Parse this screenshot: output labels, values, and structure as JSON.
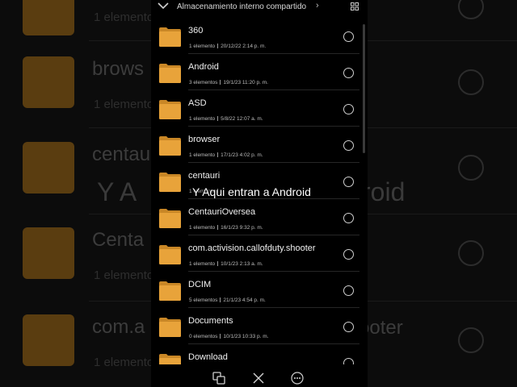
{
  "header": {
    "path_label": "Almacenamiento interno compartido",
    "path_arrow": "›",
    "back_icon": "chevron-down-icon",
    "view_icon": "grid-view-icon"
  },
  "colors": {
    "folder": "#e8a33a",
    "folder_tab": "#c98726",
    "background": "#000000"
  },
  "files": [
    {
      "name": "360",
      "count": "1 elemento",
      "date": "20/12/22 2:14 p. m."
    },
    {
      "name": "Android",
      "count": "3 elementos",
      "date": "19/1/23 11:20 p. m."
    },
    {
      "name": "ASD",
      "count": "1 elemento",
      "date": "5/8/22 12:07 a. m."
    },
    {
      "name": "browser",
      "count": "1 elemento",
      "date": "17/1/23 4:02 p. m."
    },
    {
      "name": "centauri",
      "count": "1 elemento",
      "date": ""
    },
    {
      "name": "CentauriOversea",
      "count": "1 elemento",
      "date": "16/1/23 9:32 p. m."
    },
    {
      "name": "com.activision.callofduty.shooter",
      "count": "1 elemento",
      "date": "10/1/23 2:13 a. m."
    },
    {
      "name": "DCIM",
      "count": "5 elementos",
      "date": "21/1/23 4:54 p. m."
    },
    {
      "name": "Documents",
      "count": "0 elementos",
      "date": "10/1/23 10:33 p. m."
    },
    {
      "name": "Download",
      "count": "",
      "date": ""
    }
  ],
  "overlay_caption": "Y Aqui entran a Android",
  "bottom_bar": {
    "icons": [
      "copy-icon",
      "close-icon",
      "more-icon"
    ]
  },
  "background": {
    "rows": [
      {
        "title": "",
        "sub": "1 elemento"
      },
      {
        "title": "brows",
        "sub": "1 elemento"
      },
      {
        "title": "centau",
        "sub": ""
      },
      {
        "title": "Centa",
        "sub": "1 elemento"
      },
      {
        "title": "com.a",
        "sub": "1 elemento"
      }
    ],
    "caption_left": "Y A",
    "caption_right": "roid",
    "shooter_text": "ooter"
  }
}
